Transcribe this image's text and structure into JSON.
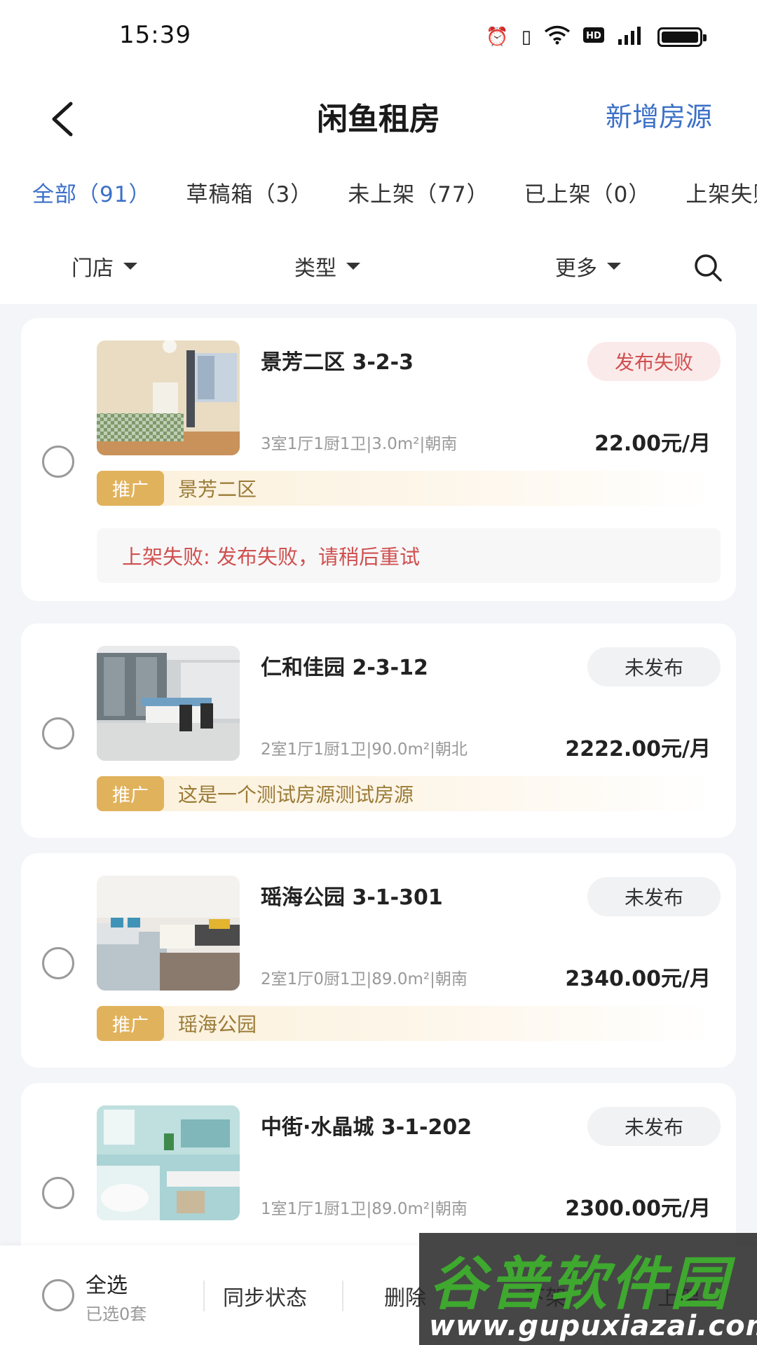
{
  "status_bar": {
    "time": "15:39",
    "icons": [
      "alarm-icon",
      "vibrate-icon",
      "wifi-icon",
      "hd-icon",
      "signal-5g-icon",
      "battery-icon"
    ]
  },
  "nav": {
    "title": "闲鱼租房",
    "action": "新增房源"
  },
  "tabs": [
    {
      "label": "全部（91）",
      "active": true
    },
    {
      "label": "草稿箱（3）"
    },
    {
      "label": "未上架（77）"
    },
    {
      "label": "已上架（0）"
    },
    {
      "label": "上架失败"
    }
  ],
  "filters": {
    "store": "门店",
    "type": "类型",
    "more": "更多"
  },
  "listings": [
    {
      "title": "景芳二区 3-2-3",
      "status": "发布失败",
      "specs": "3室1厅1厨1卫|3.0m²|朝南",
      "price": "22.00元/月",
      "promo_tag": "推广",
      "promo_text": "景芳二区",
      "error": "上架失败: 发布失败，请稍后重试"
    },
    {
      "title": "仁和佳园 2-3-12",
      "status": "未发布",
      "specs": "2室1厅1厨1卫|90.0m²|朝北",
      "price": "2222.00元/月",
      "promo_tag": "推广",
      "promo_text": "这是一个测试房源测试房源"
    },
    {
      "title": "瑶海公园 3-1-301",
      "status": "未发布",
      "specs": "2室1厅0厨1卫|89.0m²|朝南",
      "price": "2340.00元/月",
      "promo_tag": "推广",
      "promo_text": "瑶海公园"
    },
    {
      "title": "中街·水晶城 3-1-202",
      "status": "未发布",
      "specs": "1室1厅1厨1卫|89.0m²|朝南",
      "price": "2300.00元/月"
    }
  ],
  "bottom_bar": {
    "select_all": "全选",
    "selected_count": "已选0套",
    "sync": "同步状态",
    "delete": "删除",
    "unlist": "下架",
    "list": "上架"
  },
  "watermark": {
    "title": "谷普软件园",
    "url": "www.gupuxiazai.com"
  },
  "colors": {
    "accent": "#3c70c8",
    "fail": "#d0504f",
    "promo": "#e1b25c"
  }
}
